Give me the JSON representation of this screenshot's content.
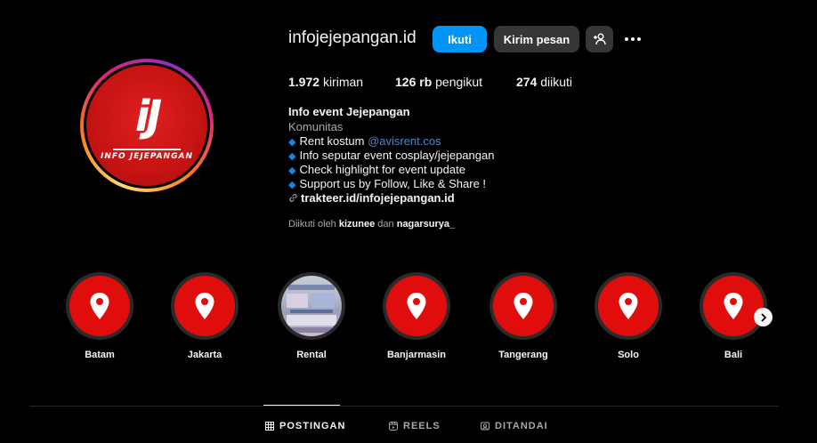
{
  "profile": {
    "username": "infojejepangan.id",
    "logo_text": "INFO JEJEPANGAN",
    "logo_mark": "iJ"
  },
  "actions": {
    "follow_label": "Ikuti",
    "message_label": "Kirim pesan",
    "add_user_icon": "add-user-icon",
    "more_icon": "more-icon"
  },
  "stats": {
    "posts_count": "1.972",
    "posts_label": "kiriman",
    "followers_count": "126 rb",
    "followers_label": "pengikut",
    "following_count": "274",
    "following_label": "diikuti"
  },
  "bio": {
    "name": "Info event Jejepangan",
    "category": "Komunitas",
    "line1_text": "Rent kostum ",
    "line1_mention": "@avisrent.cos",
    "line2": "Info seputar event cosplay/jejepangan",
    "line3": "Check highlight for event update",
    "line4": "Support us by Follow, Like & Share !",
    "link": "trakteer.id/infojejepangan.id"
  },
  "followed_by": {
    "prefix": "Diikuti oleh",
    "user1": "kizunee",
    "conj": "dan",
    "user2": "nagarsurya_"
  },
  "highlights": [
    {
      "label": "Batam"
    },
    {
      "label": "Jakarta"
    },
    {
      "label": "Rental"
    },
    {
      "label": "Banjarmasin"
    },
    {
      "label": "Tangerang"
    },
    {
      "label": "Solo"
    },
    {
      "label": "Bali"
    }
  ],
  "tabs": {
    "posts": "POSTINGAN",
    "reels": "REELS",
    "tagged": "DITANDAI"
  },
  "colors": {
    "accent": "#0095f6",
    "highlight_red": "#e00d0d",
    "bio_diamond": "#1f7fe0"
  }
}
